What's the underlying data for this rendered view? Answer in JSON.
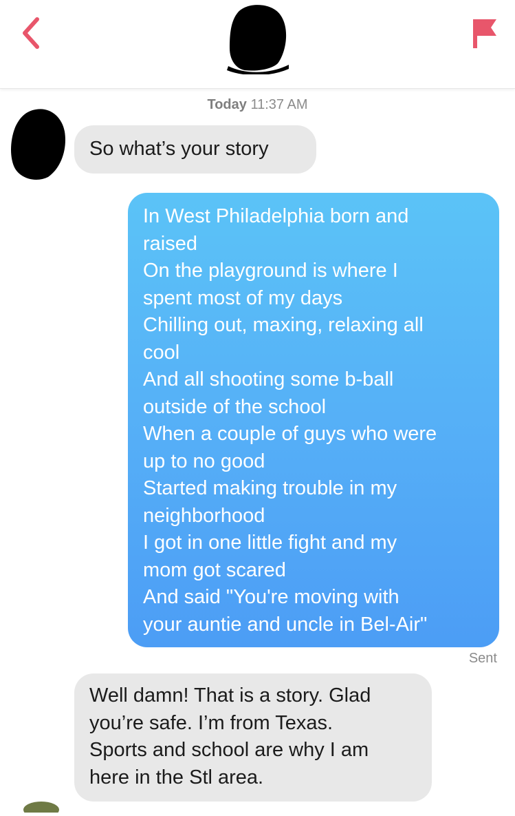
{
  "header": {
    "back_icon": "chevron-left-icon",
    "report_icon": "flag-icon",
    "accent_color": "#e8566b"
  },
  "timestamp": {
    "day": "Today",
    "time": "11:37 AM"
  },
  "messages": [
    {
      "from": "them",
      "lines": [
        "So what’s your story"
      ]
    },
    {
      "from": "me",
      "lines": [
        "In West Philadelphia born and",
        "raised",
        "On the playground is where I",
        "spent most of my days",
        "Chilling out, maxing, relaxing all",
        "cool",
        "And all shooting some b-ball",
        "outside of the school",
        "When a couple of guys who were",
        "up to no good",
        "Started making trouble in my",
        "neighborhood",
        "I got in one little fight and my",
        "mom got scared",
        "And said \"You're moving with",
        "your auntie and uncle in Bel-Air\""
      ],
      "status": "Sent"
    },
    {
      "from": "them",
      "lines": [
        "Well damn! That is a story. Glad",
        "you’re safe. I’m from Texas.",
        "Sports and school are why I am",
        "here in the Stl area."
      ]
    }
  ]
}
